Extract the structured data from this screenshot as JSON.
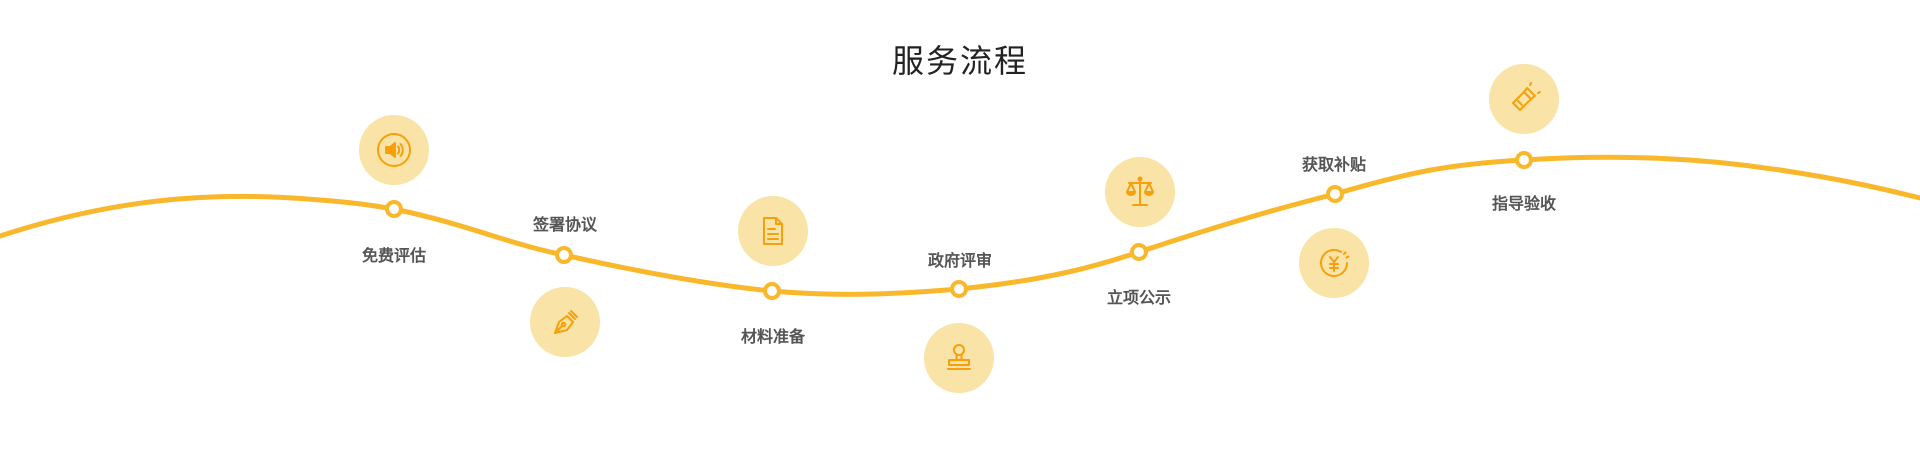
{
  "title": "服务流程",
  "colors": {
    "curve": "#f9b82b",
    "icon_bg": "#f9e3a6",
    "icon_stroke": "#f5a00c",
    "label": "#555555",
    "title": "#222222"
  },
  "steps": [
    {
      "label": "免费评估",
      "icon": "speaker-icon"
    },
    {
      "label": "签署协议",
      "icon": "pen-nib-icon"
    },
    {
      "label": "材料准备",
      "icon": "document-icon"
    },
    {
      "label": "政府评审",
      "icon": "stamp-icon"
    },
    {
      "label": "立项公示",
      "icon": "scales-icon"
    },
    {
      "label": "获取补贴",
      "icon": "yuan-coin-icon"
    },
    {
      "label": "指导验收",
      "icon": "flashlight-icon"
    }
  ]
}
